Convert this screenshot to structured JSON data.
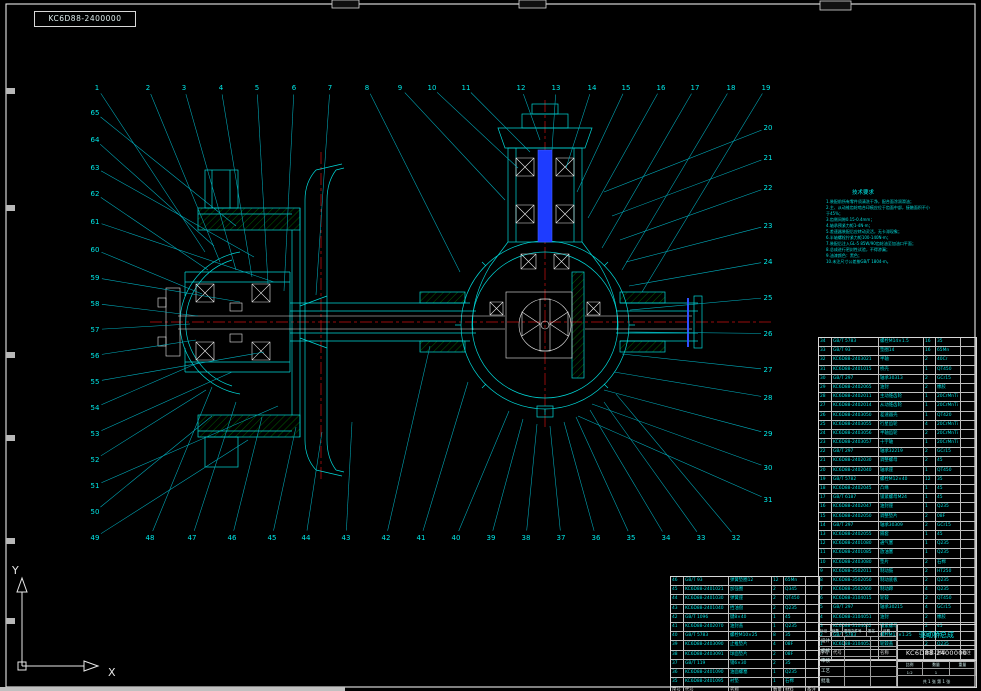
{
  "colors": {
    "accent_cyan": "#00dede",
    "line_white": "#e8e8e8",
    "hatch_green": "#00a000",
    "centerline_red": "#cc1111",
    "highlight_blue": "#1e3cff"
  },
  "corner_label": {
    "text": "KC6D88-2400000"
  },
  "ucs": {
    "x_label": "X",
    "y_label": "Y"
  },
  "notes": {
    "title": "技术要求",
    "lines": [
      "1.装配前所有零件须清洗干净，配合面涂润滑油；",
      "2.主、从动锥齿轮啮合印痕应位于齿面中部，接触面积不小于45%；",
      "3.齿侧间隙0.15-0.4mm；",
      "4.轴承预紧力矩1-4N·m；",
      "5.差速器装配后应转动灵活，无卡滞现象；",
      "6.半轴螺栓拧紧力矩100-140N·m；",
      "7.装配后注入GL-5 85W/90齿轮油至加油口平面；",
      "8.总成进行密封性试验，不得渗漏；",
      "9.油漆颜色：黑色；",
      "10.未注尺寸公差按GB/T 1804-m。"
    ]
  },
  "bom_header": [
    "序号",
    "代号",
    "名称",
    "数量",
    "材料",
    "备注"
  ],
  "bom_right": {
    "rows": [
      [
        "34",
        "GB/T 5783",
        "螺栓M14×1.5",
        "16",
        "35"
      ],
      [
        "33",
        "GB/T 93",
        "垫圈14",
        "16",
        "65Mn"
      ],
      [
        "32",
        "KC6D88-2403021",
        "半轴",
        "2",
        "40Cr"
      ],
      [
        "31",
        "KC6D88-2401015",
        "桥壳",
        "1",
        "QT450"
      ],
      [
        "30",
        "GB/T 297",
        "轴承30313",
        "2",
        "GCr15"
      ],
      [
        "29",
        "KC6D88-2402065",
        "油封",
        "2",
        "橡胶"
      ],
      [
        "28",
        "KC6D88-2402011",
        "主动锥齿轮",
        "1",
        "20CrMnTi"
      ],
      [
        "27",
        "KC6D88-2402014",
        "从动锥齿轮",
        "1",
        "20CrMnTi"
      ],
      [
        "26",
        "KC6D88-2403050",
        "差速器壳",
        "1",
        "QT420"
      ],
      [
        "25",
        "KC6D88-2403055",
        "行星齿轮",
        "4",
        "20CrMnTi"
      ],
      [
        "24",
        "KC6D88-2403056",
        "半轴齿轮",
        "2",
        "20CrMnTi"
      ],
      [
        "23",
        "KC6D88-2403057",
        "十字轴",
        "1",
        "20CrMnTi"
      ],
      [
        "22",
        "GB/T 297",
        "轴承32219",
        "2",
        "GCr15"
      ],
      [
        "21",
        "KC6D88-2402030",
        "调整螺母",
        "2",
        "45"
      ],
      [
        "20",
        "KC6D88-2402040",
        "轴承座",
        "1",
        "QT450"
      ],
      [
        "19",
        "GB/T 5782",
        "螺栓M12×40",
        "12",
        "35"
      ],
      [
        "18",
        "KC6D88-2402045",
        "凸缘",
        "1",
        "45"
      ],
      [
        "17",
        "GB/T 6187",
        "锁紧螺母M24",
        "1",
        "45"
      ],
      [
        "16",
        "KC6D88-2402047",
        "油封座",
        "1",
        "Q235"
      ],
      [
        "15",
        "KC6D88-2402050",
        "调整垫片",
        "2",
        "08F"
      ],
      [
        "14",
        "GB/T 297",
        "轴承30309",
        "2",
        "GCr15"
      ],
      [
        "13",
        "KC6D88-2402055",
        "隔套",
        "1",
        "45"
      ],
      [
        "12",
        "KC6D88-2401080",
        "通气塞",
        "1",
        "Q235"
      ],
      [
        "11",
        "KC6D88-2401085",
        "放油塞",
        "1",
        "Q235"
      ],
      [
        "10",
        "KC6D88-2403080",
        "垫片",
        "2",
        "石棉"
      ],
      [
        "9",
        "KC6D88-3502011",
        "制动鼓",
        "2",
        "HT250"
      ],
      [
        "8",
        "KC6D88-3502050",
        "制动底板",
        "2",
        "Q235"
      ],
      [
        "7",
        "KC6D88-3502060",
        "制动蹄",
        "4",
        "Q235"
      ],
      [
        "6",
        "KC6D88-3104015",
        "轮毂",
        "2",
        "QT450"
      ],
      [
        "5",
        "GB/T 297",
        "轴承30215",
        "4",
        "GCr15"
      ],
      [
        "4",
        "KC6D88-3104051",
        "油封",
        "2",
        "橡胶"
      ],
      [
        "3",
        "KC6D88-3104052",
        "锁紧螺母",
        "2",
        "45"
      ],
      [
        "2",
        "GB/T 5783",
        "螺栓M12×1.25",
        "20",
        "35"
      ],
      [
        "1",
        "KC6D88-3104053",
        "轮毂盖",
        "2",
        "Q235"
      ]
    ]
  },
  "bom_left": {
    "rows": [
      [
        "46",
        "GB/T 93",
        "弹簧垫圈12",
        "12",
        "65Mn"
      ],
      [
        "45",
        "KC6D88-2401021",
        "加强圈",
        "2",
        "Q345"
      ],
      [
        "44",
        "KC6D88-2401030",
        "弹簧座",
        "2",
        "QT450"
      ],
      [
        "43",
        "KC6D88-2401040",
        "挡油盘",
        "2",
        "Q235"
      ],
      [
        "42",
        "GB/T 1096",
        "键8×40",
        "1",
        "45"
      ],
      [
        "41",
        "KC6D88-2402070",
        "油封盖",
        "1",
        "Q235"
      ],
      [
        "40",
        "GB/T 5783",
        "螺栓M10×25",
        "8",
        "35"
      ],
      [
        "39",
        "KC6D88-2403090",
        "止推垫片",
        "4",
        "08F"
      ],
      [
        "38",
        "KC6D88-2403091",
        "球面垫片",
        "2",
        "08F"
      ],
      [
        "37",
        "GB/T 119",
        "销6×30",
        "2",
        "35"
      ],
      [
        "36",
        "KC6D88-2401090",
        "油面螺塞",
        "1",
        "Q235"
      ],
      [
        "35",
        "KC6D88-2401095",
        "衬垫",
        "1",
        "石棉"
      ]
    ]
  },
  "title_block": {
    "name": "驱动桥总成",
    "number": "KC6D88-2400000",
    "cols": [
      "标记",
      "处数",
      "更改文件号",
      "签名",
      "日期"
    ],
    "roles": [
      "设计",
      "校核",
      "审核",
      "工艺",
      "批准"
    ],
    "scale_label": "比例",
    "scale": "1:2",
    "qty_label": "数量",
    "qty": "1",
    "weight_label": "重量",
    "weight": "",
    "sheet": "共 1 张  第 1 张"
  },
  "callouts": [
    [
      "1",
      97,
      90,
      205,
      252
    ],
    [
      "2",
      148,
      90,
      220,
      262
    ],
    [
      "3",
      184,
      90,
      236,
      270
    ],
    [
      "4",
      221,
      90,
      252,
      277
    ],
    [
      "5",
      257,
      90,
      268,
      284
    ],
    [
      "6",
      294,
      90,
      284,
      291
    ],
    [
      "7",
      330,
      90,
      316,
      295
    ],
    [
      "8",
      367,
      90,
      460,
      272
    ],
    [
      "9",
      400,
      90,
      505,
      200
    ],
    [
      "10",
      432,
      90,
      518,
      168
    ],
    [
      "11",
      466,
      90,
      530,
      152
    ],
    [
      "12",
      521,
      90,
      540,
      140
    ],
    [
      "13",
      556,
      90,
      552,
      150
    ],
    [
      "14",
      592,
      90,
      566,
      168
    ],
    [
      "15",
      626,
      90,
      577,
      192
    ],
    [
      "16",
      661,
      90,
      588,
      218
    ],
    [
      "17",
      695,
      90,
      602,
      248
    ],
    [
      "18",
      731,
      90,
      622,
      270
    ],
    [
      "19",
      766,
      90,
      642,
      292
    ],
    [
      "20",
      768,
      130,
      604,
      192
    ],
    [
      "21",
      768,
      160,
      612,
      216
    ],
    [
      "22",
      768,
      190,
      620,
      240
    ],
    [
      "23",
      768,
      228,
      626,
      262
    ],
    [
      "24",
      768,
      264,
      629,
      286
    ],
    [
      "25",
      768,
      300,
      630,
      310
    ],
    [
      "26",
      768,
      336,
      628,
      332
    ],
    [
      "27",
      768,
      372,
      622,
      354
    ],
    [
      "28",
      768,
      400,
      614,
      372
    ],
    [
      "29",
      768,
      436,
      604,
      390
    ],
    [
      "30",
      768,
      470,
      592,
      404
    ],
    [
      "31",
      768,
      502,
      578,
      416
    ],
    [
      "32",
      736,
      540,
      616,
      394
    ],
    [
      "33",
      701,
      540,
      604,
      402
    ],
    [
      "34",
      666,
      540,
      590,
      410
    ],
    [
      "35",
      631,
      540,
      576,
      417
    ],
    [
      "36",
      596,
      540,
      564,
      422
    ],
    [
      "37",
      561,
      540,
      550,
      426
    ],
    [
      "38",
      526,
      540,
      537,
      424
    ],
    [
      "39",
      491,
      540,
      523,
      419
    ],
    [
      "40",
      456,
      540,
      509,
      411
    ],
    [
      "41",
      421,
      540,
      468,
      382
    ],
    [
      "42",
      386,
      540,
      430,
      346
    ],
    [
      "43",
      346,
      540,
      352,
      422
    ],
    [
      "44",
      306,
      540,
      322,
      432
    ],
    [
      "45",
      272,
      540,
      296,
      427
    ],
    [
      "46",
      232,
      540,
      262,
      417
    ],
    [
      "47",
      192,
      540,
      236,
      402
    ],
    [
      "48",
      150,
      540,
      212,
      387
    ],
    [
      "49",
      95,
      540,
      248,
      440
    ],
    [
      "50",
      95,
      514,
      212,
      416
    ],
    [
      "51",
      95,
      488,
      278,
      406
    ],
    [
      "52",
      95,
      462,
      206,
      390
    ],
    [
      "53",
      95,
      436,
      232,
      372
    ],
    [
      "54",
      95,
      410,
      200,
      362
    ],
    [
      "55",
      95,
      384,
      264,
      352
    ],
    [
      "56",
      95,
      358,
      196,
      340
    ],
    [
      "57",
      95,
      332,
      190,
      324
    ],
    [
      "58",
      95,
      306,
      198,
      316
    ],
    [
      "59",
      95,
      280,
      240,
      302
    ],
    [
      "60",
      95,
      252,
      202,
      294
    ],
    [
      "61",
      95,
      224,
      274,
      282
    ],
    [
      "62",
      95,
      196,
      208,
      270
    ],
    [
      "63",
      95,
      170,
      254,
      257
    ],
    [
      "64",
      95,
      142,
      214,
      246
    ],
    [
      "65",
      95,
      115,
      236,
      226
    ]
  ]
}
